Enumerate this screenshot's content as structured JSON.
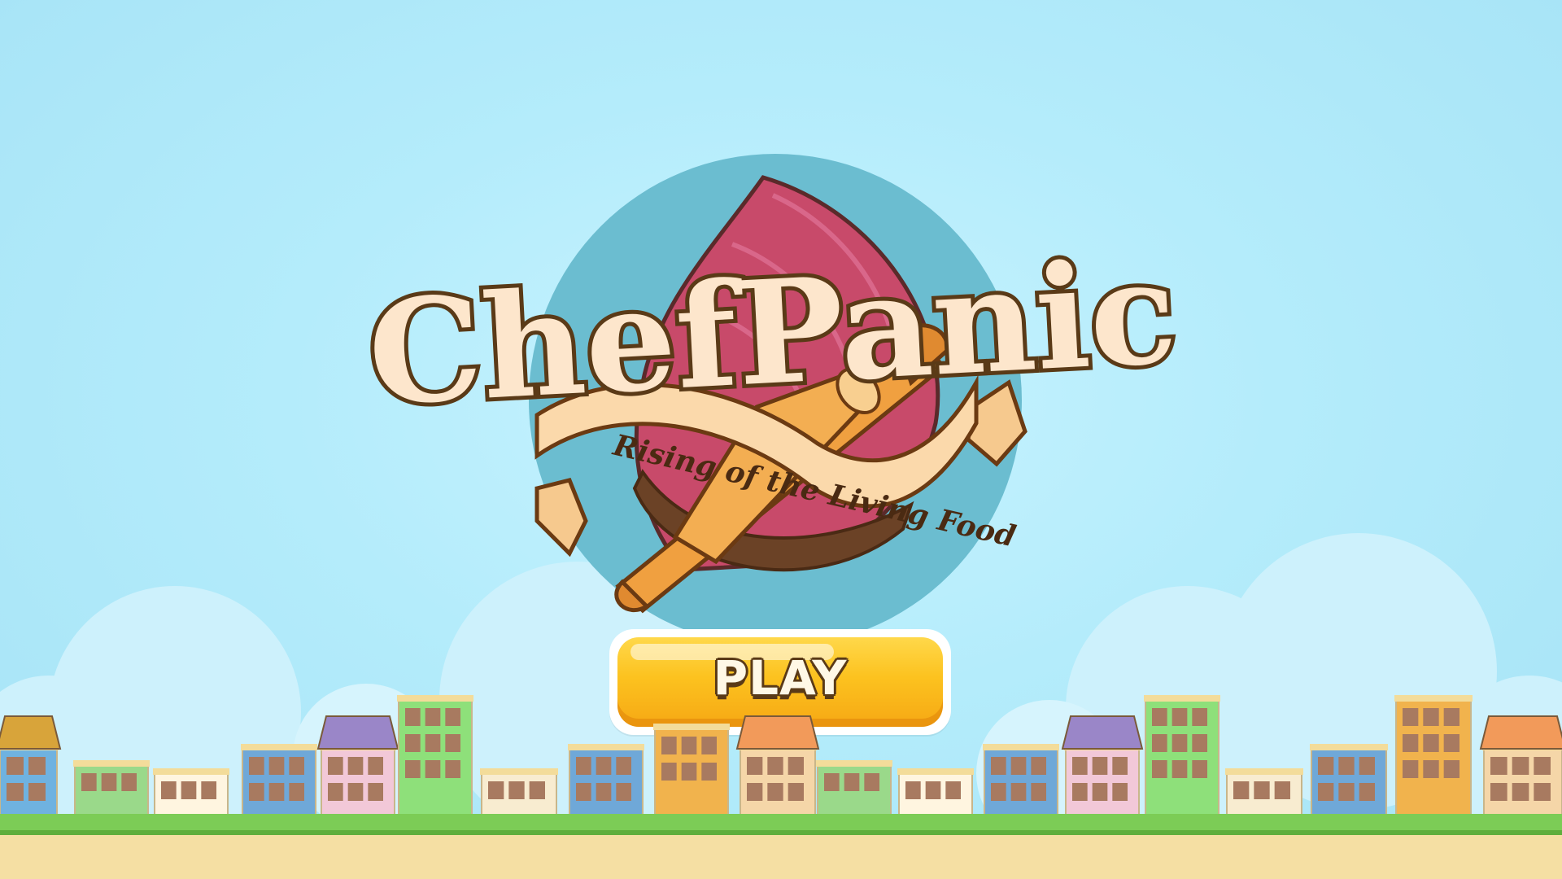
{
  "game": {
    "title": "ChefPanic",
    "subtitle": "Rising of the Living Food",
    "play_label": "PLAY"
  },
  "colors": {
    "sky_light": "#c8f3ff",
    "sky_edge": "#a6e3f6",
    "logo_circle": "#6bbdd0",
    "meat_red": "#c84a6a",
    "title_cream": "#fde6cc",
    "outline_brown": "#5a3a17",
    "ribbon": "#fbd9ab",
    "rolling_pin": "#f0a040",
    "play_button": "#fcc21f",
    "grass": "#7ccc56",
    "sand": "#f5dfa3"
  },
  "icons": [
    "meat-icon",
    "rolling-pin-icon",
    "ribbon-banner-icon"
  ]
}
